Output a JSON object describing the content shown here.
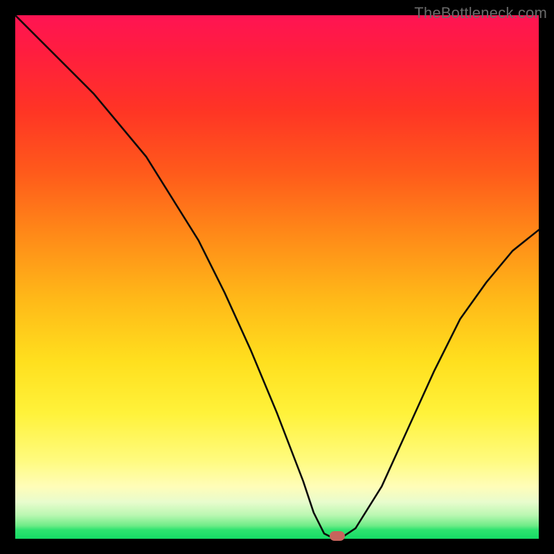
{
  "watermark": "TheBottleneck.com",
  "accent_color": "#15db65",
  "chart_data": {
    "type": "line",
    "title": "",
    "xlabel": "",
    "ylabel": "",
    "xlim": [
      0,
      100
    ],
    "ylim": [
      0,
      100
    ],
    "x": [
      0,
      5,
      10,
      15,
      20,
      25,
      30,
      35,
      40,
      45,
      50,
      55,
      57,
      59,
      61,
      62,
      65,
      70,
      75,
      80,
      85,
      90,
      95,
      100
    ],
    "y": [
      100,
      95,
      90,
      85,
      79,
      73,
      65,
      57,
      47,
      36,
      24,
      11,
      5,
      1,
      0,
      0,
      2,
      10,
      21,
      32,
      42,
      49,
      55,
      59
    ],
    "marker": {
      "x": 61.5,
      "y": 0.5
    },
    "gradient_stops": [
      {
        "pos": 0,
        "color": "#ff1453"
      },
      {
        "pos": 50,
        "color": "#ffc81a"
      },
      {
        "pos": 90,
        "color": "#fffdb8"
      },
      {
        "pos": 100,
        "color": "#15db65"
      }
    ]
  }
}
